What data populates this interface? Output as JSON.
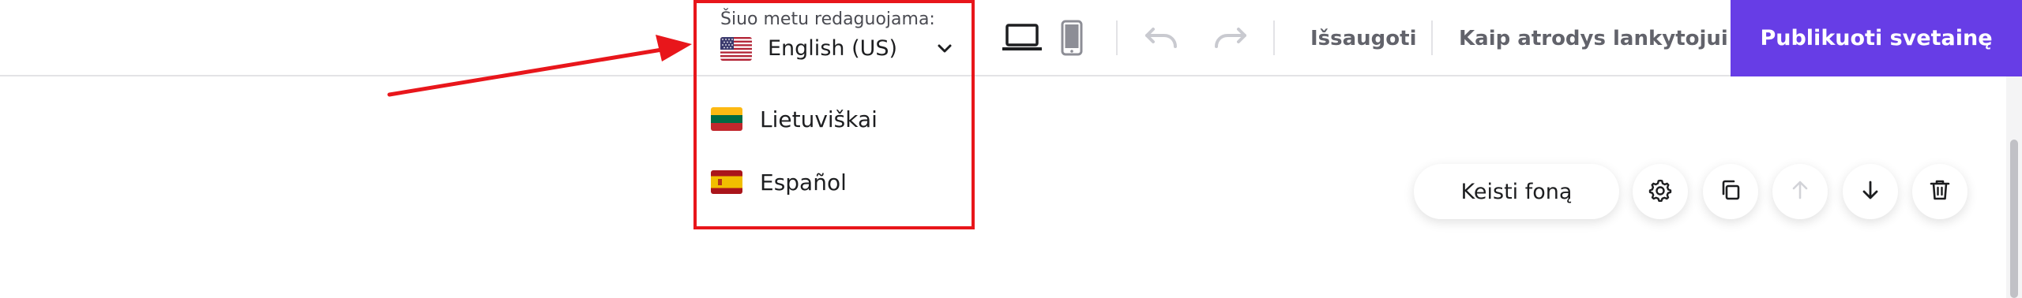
{
  "language_selector": {
    "caption": "Šiuo metu redaguojama:",
    "current_language": "English (US)",
    "current_flag_icon": "flag-us-icon",
    "options": [
      {
        "label": "Lietuviškai",
        "flag_icon": "flag-lt-icon"
      },
      {
        "label": "Español",
        "flag_icon": "flag-es-icon"
      }
    ]
  },
  "toolbar": {
    "device_icons": [
      "laptop-icon",
      "mobile-icon"
    ],
    "history_icons": [
      "undo-icon",
      "redo-icon"
    ],
    "saved_label": "Išsaugoti",
    "preview_label": "Kaip atrodys lankytojui",
    "publish_label": "Publikuoti svetainę"
  },
  "section_toolbar": {
    "change_background_label": "Keisti foną",
    "icons": [
      "gear-icon",
      "duplicate-icon",
      "arrow-up-icon",
      "arrow-down-icon",
      "trash-icon"
    ]
  },
  "colors": {
    "accent": "#673de6",
    "highlight": "#e8161b",
    "text": "#1d1e20",
    "muted_text": "#62636b",
    "disabled_icon": "#c9cad0"
  }
}
